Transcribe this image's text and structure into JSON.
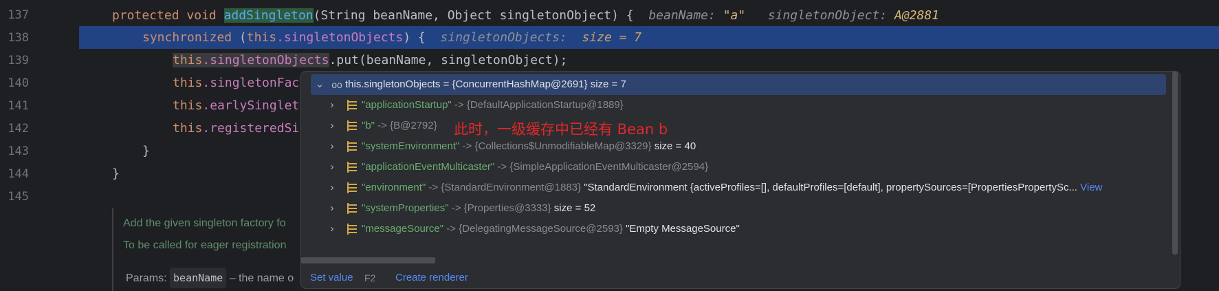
{
  "editor": {
    "line_numbers": [
      "137",
      "138",
      "139",
      "140",
      "141",
      "142",
      "143",
      "144",
      "145"
    ],
    "line137": {
      "kw1": "protected",
      "kw2": "void",
      "method": "addSingleton",
      "params": "(String beanName, Object singletonObject) {",
      "hint_name_label": "beanName:",
      "hint_name_value": "\"a\"",
      "hint_obj_label": "singletonObject:",
      "hint_obj_value": "A@2881"
    },
    "line138": {
      "kw": "synchronized",
      "open": " (",
      "this": "this",
      "dot_field": ".singletonObjects",
      "close": ") {",
      "hint_label": "singletonObjects:",
      "hint_value": "size = 7"
    },
    "line139": {
      "this": "this",
      "field": ".singletonObjects",
      "rest": ".put(beanName, singletonObject);"
    },
    "line140": {
      "this": "this",
      "field": ".singletonFac"
    },
    "line141": {
      "this": "this",
      "field": ".earlySinglet"
    },
    "line142": {
      "this": "this",
      "field": ".registeredSi"
    },
    "line143": "}",
    "line144": "}"
  },
  "doc": {
    "line1": "Add the given singleton factory fo",
    "line2": "To be called for eager registration",
    "params_label": "Params:",
    "param_chip": "beanName",
    "param_desc": "– the name o"
  },
  "debug_popup": {
    "root": {
      "eyes_icon": "watch-glasses-icon",
      "expression": "this.singletonObjects = {ConcurrentHashMap@2691}",
      "size": "size = 7"
    },
    "entries": [
      {
        "key": "\"applicationStartup\"",
        "arrow": "->",
        "type": "{DefaultApplicationStartup@1889}",
        "value": ""
      },
      {
        "key": "\"b\"",
        "arrow": "->",
        "type": "{B@2792}",
        "value": ""
      },
      {
        "key": "\"systemEnvironment\"",
        "arrow": "->",
        "type": "{Collections$UnmodifiableMap@3329}",
        "value": "size = 40"
      },
      {
        "key": "\"applicationEventMulticaster\"",
        "arrow": "->",
        "type": "{SimpleApplicationEventMulticaster@2594}",
        "value": ""
      },
      {
        "key": "\"environment\"",
        "arrow": "->",
        "type": "{StandardEnvironment@1883}",
        "value": "\"StandardEnvironment {activeProfiles=[], defaultProfiles=[default], propertySources=[PropertiesPropertySc...",
        "link": "View"
      },
      {
        "key": "\"systemProperties\"",
        "arrow": "->",
        "type": "{Properties@3333}",
        "value": "size = 52"
      },
      {
        "key": "\"messageSource\"",
        "arrow": "->",
        "type": "{DelegatingMessageSource@2593}",
        "value": "\"Empty MessageSource\""
      }
    ],
    "annotation": "此时，一级缓存中已经有 Bean b",
    "footer": {
      "set_value": "Set value",
      "set_value_shortcut": "F2",
      "create_renderer": "Create renderer"
    }
  },
  "colors": {
    "background": "#1e1f22",
    "current_line": "#214283",
    "annotation": "#e0282a",
    "link": "#548af7"
  }
}
